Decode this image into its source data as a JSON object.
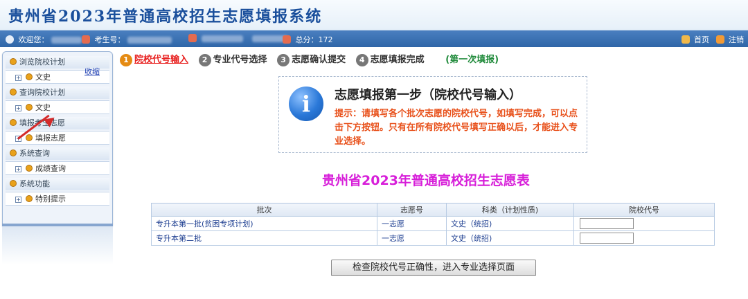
{
  "header": {
    "title": "贵州省2023年普通高校招生志愿填报系统"
  },
  "status": {
    "welcome_label": "欢迎您：",
    "exam_label": "考生号：",
    "score_label": "总分：",
    "score_value": "172",
    "home": "首页",
    "logout": "注销"
  },
  "sidebar": {
    "collapse": "收缩",
    "sections": [
      {
        "label": "浏览院校计划",
        "item": "文史"
      },
      {
        "label": "查询院校计划",
        "item": "文史"
      },
      {
        "label": "填报考生志愿",
        "item": "填报志愿"
      },
      {
        "label": "系统查询",
        "item": "成绩查询"
      },
      {
        "label": "系统功能",
        "item": "特别提示"
      }
    ]
  },
  "steps": {
    "items": [
      {
        "num": "1",
        "label": "院校代号输入"
      },
      {
        "num": "2",
        "label": "专业代号选择"
      },
      {
        "num": "3",
        "label": "志愿确认提交"
      },
      {
        "num": "4",
        "label": "志愿填报完成"
      }
    ],
    "round": "(第一次填报)"
  },
  "info": {
    "icon": "info-icon",
    "title": "志愿填报第一步（院校代号输入）",
    "text": "提示：请填写各个批次志愿的院校代号，如填写完成，可以点击下方按钮。只有在所有院校代号填写正确以后，才能进入专业选择。"
  },
  "form": {
    "title": "贵州省2023年普通高校招生志愿表",
    "columns": [
      "批次",
      "志愿号",
      "科类（计划性质)",
      "院校代号"
    ],
    "rows": [
      {
        "batch": "专升本第一批(贫困专项计划)",
        "vol": "一志愿",
        "type": "文史（统招)",
        "code": ""
      },
      {
        "batch": "专升本第二批",
        "vol": "一志愿",
        "type": "文史（统招)",
        "code": ""
      }
    ],
    "submit": "检查院校代号正确性，进入专业选择页面"
  },
  "colors": {
    "accent": "#1a4f9c",
    "active_step": "#e8201f",
    "form_title": "#d71fd9",
    "tip_text": "#e8501a"
  }
}
